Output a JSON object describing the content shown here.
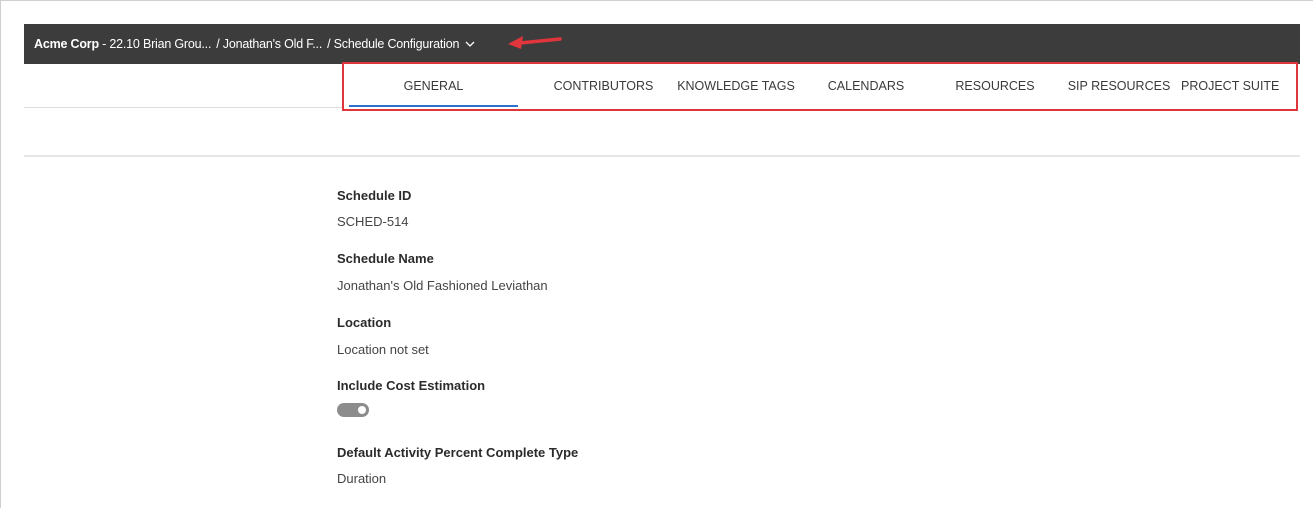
{
  "breadcrumb": {
    "org": "Acme Corp",
    "project": " - 22.10 Brian Grou...",
    "schedule": "/ Jonathan's Old F...",
    "page": "/ Schedule Configuration"
  },
  "tabs": [
    {
      "label": "GENERAL",
      "active": true
    },
    {
      "label": "CONTRIBUTORS",
      "active": false
    },
    {
      "label": "KNOWLEDGE TAGS",
      "active": false
    },
    {
      "label": "CALENDARS",
      "active": false
    },
    {
      "label": "RESOURCES",
      "active": false
    },
    {
      "label": "SIP RESOURCES",
      "active": false
    },
    {
      "label": "PROJECT SUITE",
      "active": false
    }
  ],
  "fields": {
    "schedule_id": {
      "label": "Schedule ID",
      "value": "SCHED-514"
    },
    "schedule_name": {
      "label": "Schedule Name",
      "value": "Jonathan's Old Fashioned Leviathan"
    },
    "location": {
      "label": "Location",
      "value": "Location not set"
    },
    "include_cost": {
      "label": "Include Cost Estimation",
      "enabled": true
    },
    "percent_type": {
      "label": "Default Activity Percent Complete Type",
      "value": "Duration"
    }
  },
  "colors": {
    "topbar": "#3c3c3c",
    "active_tab_underline": "#2f6fce",
    "annotation": "#e0353b",
    "toggle": "#8c8c8c"
  },
  "icons": {
    "breadcrumb_dropdown": "chevron-down-icon",
    "annotation": "arrow-left-icon"
  }
}
